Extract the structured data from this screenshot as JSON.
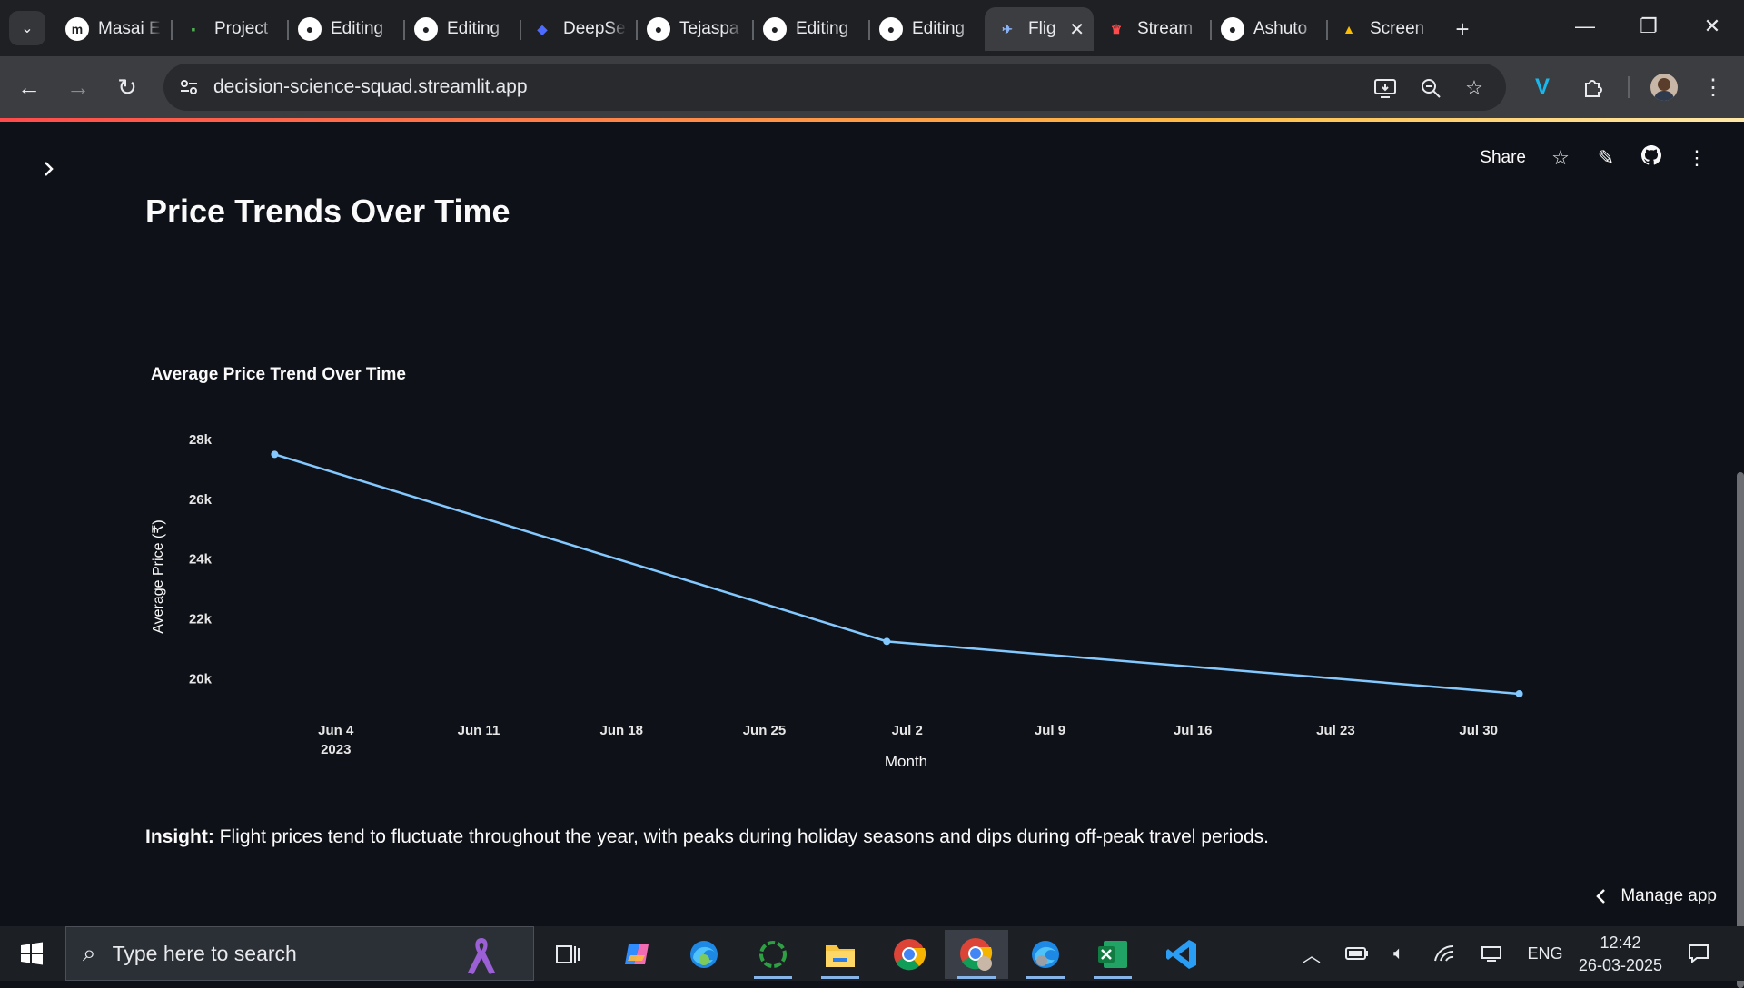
{
  "browser": {
    "tabs": [
      {
        "title": "Masai E",
        "icon": "masai-icon",
        "color": "#ffffff"
      },
      {
        "title": "Project",
        "icon": "project-icon",
        "color": "#4caf50"
      },
      {
        "title": "Editing",
        "icon": "github-icon",
        "color": "#ffffff"
      },
      {
        "title": "Editing",
        "icon": "github-icon",
        "color": "#ffffff"
      },
      {
        "title": "DeepSe",
        "icon": "deepseek-icon",
        "color": "#4d6bfe"
      },
      {
        "title": "Tejaspa",
        "icon": "github-icon",
        "color": "#ffffff"
      },
      {
        "title": "Editing",
        "icon": "github-icon",
        "color": "#ffffff"
      },
      {
        "title": "Editing",
        "icon": "github-icon",
        "color": "#ffffff"
      },
      {
        "title": "Flig",
        "icon": "airplane-icon",
        "color": "#8ab4f8",
        "active": true
      },
      {
        "title": "Stream",
        "icon": "streamlit-icon",
        "color": "#ff4b4b"
      },
      {
        "title": "Ashuto",
        "icon": "github-icon",
        "color": "#ffffff"
      },
      {
        "title": "Screen",
        "icon": "drive-icon",
        "color": "#fbbc04"
      }
    ],
    "url": "decision-science-squad.streamlit.app"
  },
  "app": {
    "header": {
      "share_label": "Share"
    },
    "title": "Price Trends Over Time",
    "insight_label": "Insight:",
    "insight_text": " Flight prices tend to fluctuate throughout the year, with peaks during holiday seasons and dips during off-peak travel periods.",
    "manage_label": "Manage app"
  },
  "chart_data": {
    "type": "line",
    "title": "Average Price Trend Over Time",
    "xlabel": "Month",
    "ylabel": "Average Price (₹)",
    "x_ticks": [
      "Jun 4",
      "Jun 11",
      "Jun 18",
      "Jun 25",
      "Jul 2",
      "Jul 9",
      "Jul 16",
      "Jul 23",
      "Jul 30"
    ],
    "x_tick_sublabel": "2023",
    "y_ticks": [
      "20k",
      "22k",
      "24k",
      "26k",
      "28k"
    ],
    "ylim": [
      19500,
      28300
    ],
    "xlim": [
      "2023-05-29",
      "2023-08-04"
    ],
    "grid": false,
    "line_color": "#83c9ff",
    "series": [
      {
        "x": [
          "2023-06-01",
          "2023-07-01",
          "2023-08-01"
        ],
        "values": [
          27500,
          21250,
          19500
        ]
      }
    ]
  },
  "taskbar": {
    "search_placeholder": "Type here to search",
    "language": "ENG",
    "time": "12:42",
    "date": "26-03-2025"
  }
}
